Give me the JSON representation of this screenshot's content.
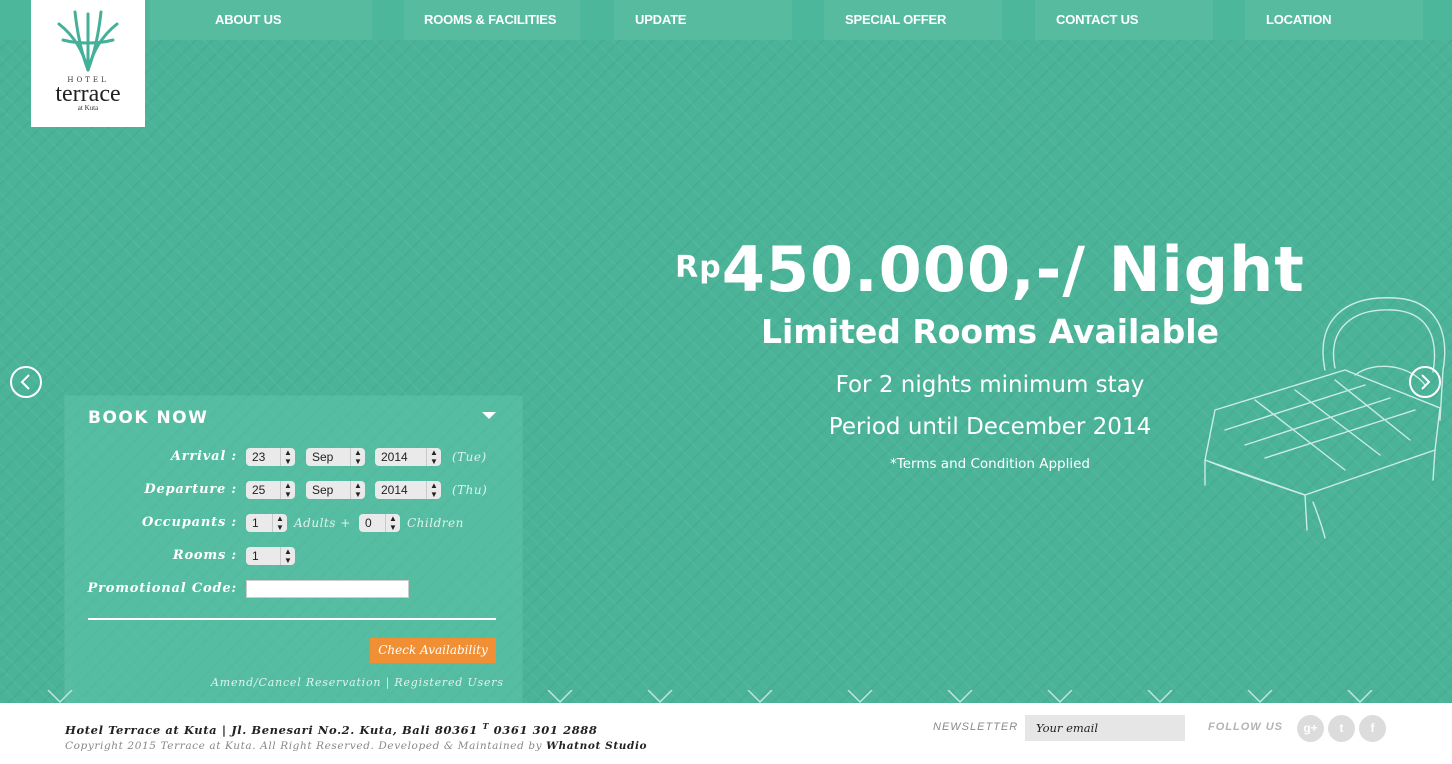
{
  "nav": {
    "items": [
      "ABOUT US",
      "ROOMS & FACILITIES",
      "UPDATE",
      "SPECIAL OFFER",
      "CONTACT US",
      "LOCATION"
    ]
  },
  "logo": {
    "hotel": "HOTEL",
    "name": "terrace",
    "sub": "at Kuta"
  },
  "offer": {
    "price_prefix": "Rp",
    "price": "450.000,-/ Night",
    "line2": "Limited Rooms Available",
    "line3": "For 2 nights minimum stay",
    "line4": "Period until December 2014",
    "terms": "*Terms and Condition Applied"
  },
  "booking": {
    "title": "BOOK NOW",
    "arrival_label": "Arrival :",
    "arrival": {
      "day": "23",
      "month": "Sep",
      "year": "2014",
      "weekday": "(Tue)"
    },
    "departure_label": "Departure :",
    "departure": {
      "day": "25",
      "month": "Sep",
      "year": "2014",
      "weekday": "(Thu)"
    },
    "occupants_label": "Occupants :",
    "adults": "1",
    "adults_suffix": "Adults +",
    "children": "0",
    "children_suffix": "Children",
    "rooms_label": "Rooms :",
    "rooms": "1",
    "promo_label": "Promotional Code:",
    "promo_value": "",
    "check_button": "Check Availability",
    "amend_link": "Amend/Cancel Reservation",
    "separator": "|",
    "registered_link": "Registered Users"
  },
  "footer": {
    "address": "Hotel Terrace at Kuta | Jl. Benesari No.2. Kuta, Bali 80361",
    "phone_prefix": "T",
    "phone": "0361 301 2888",
    "copyright": "Copyright 2015 Terrace at Kuta. All Right Reserved. Developed & Maintained by",
    "developer": "Whatnot Studio",
    "newsletter_label": "NEWSLETTER",
    "newsletter_placeholder": "Your email",
    "follow_label": "FOLLOW US",
    "social_icons": [
      "google-plus-icon",
      "twitter-icon",
      "facebook-icon"
    ]
  },
  "colors": {
    "accent": "#4ab398",
    "button": "#f18f34"
  }
}
